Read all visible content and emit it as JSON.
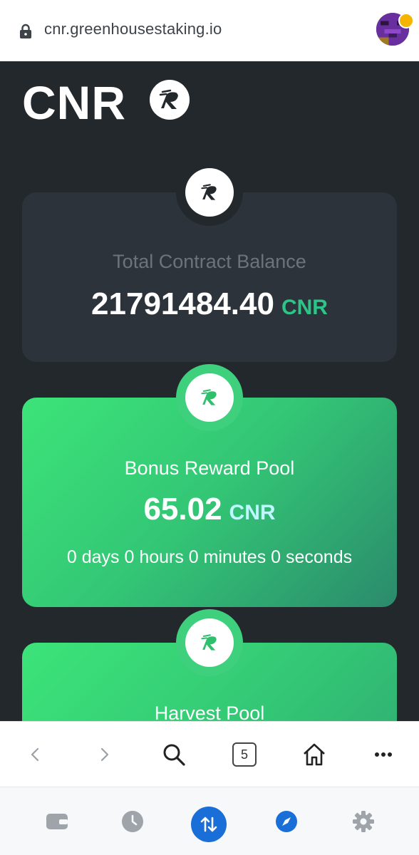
{
  "browser": {
    "url": "cnr.greenhousestaking.io",
    "tab_count": "5"
  },
  "header": {
    "title": "CNR"
  },
  "cards": {
    "balance": {
      "label": "Total Contract Balance",
      "value": "21791484.40",
      "unit": "CNR"
    },
    "bonus_pool": {
      "title": "Bonus Reward Pool",
      "value": "65.02",
      "unit": "CNR",
      "timer": "0 days 0 hours 0 minutes 0 seconds"
    },
    "harvest_pool": {
      "title": "Harvest Pool"
    }
  },
  "colors": {
    "page_bg": "#23282d",
    "card_dark": "#2d333b",
    "green_start": "#3ce479",
    "green_end": "#2b8a6c",
    "accent_cnr": "#2cc487",
    "app_active": "#1a6ed8"
  }
}
